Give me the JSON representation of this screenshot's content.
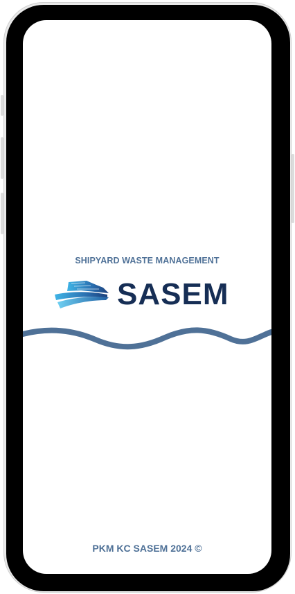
{
  "app": {
    "tagline": "SHIPYARD WASTE MANAGEMENT",
    "brand_name": "SASEM",
    "footer": "PKM KC SASEM 2024 ©"
  },
  "colors": {
    "tagline": "#4f7197",
    "brand_text": "#162e55",
    "wave": "#4f7197",
    "background": "#ffffff",
    "bezel": "#000000"
  },
  "icons": {
    "logo": "ship-hull-logo-icon",
    "decoration": "wave-divider"
  }
}
